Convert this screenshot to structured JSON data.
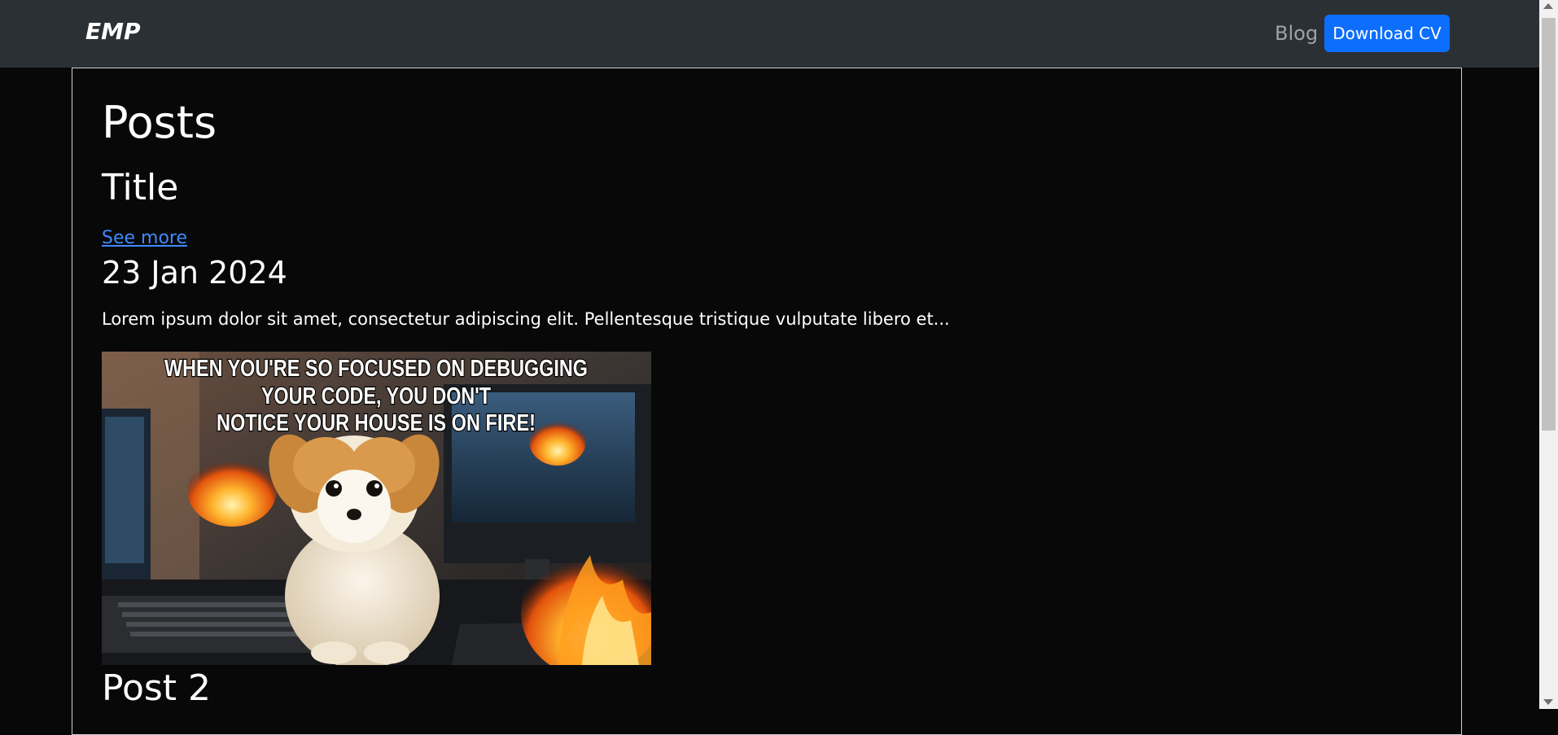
{
  "navbar": {
    "brand": "EMP",
    "links": [
      {
        "label": "Blog"
      }
    ],
    "cta_label": "Download CV"
  },
  "page": {
    "heading": "Posts"
  },
  "posts": [
    {
      "title": "Title",
      "see_more": "See more",
      "date": "23 Jan 2024",
      "excerpt": "Lorem ipsum dolor sit amet, consectetur adipiscing elit. Pellentesque tristique vulputate libero et...",
      "image_caption_lines": [
        "WHEN YOU'RE SO FOCUSED ON DEBUGGING",
        "YOUR CODE, YOU DON'T",
        "NOTICE YOUR HOUSE IS ON FIRE!"
      ]
    },
    {
      "title": "Post 2"
    }
  ],
  "colors": {
    "navbar_bg": "#2b3035",
    "page_bg": "#080808",
    "accent": "#0d6efd",
    "link": "#3d8bfd",
    "nav_link": "#9ea2a6"
  }
}
